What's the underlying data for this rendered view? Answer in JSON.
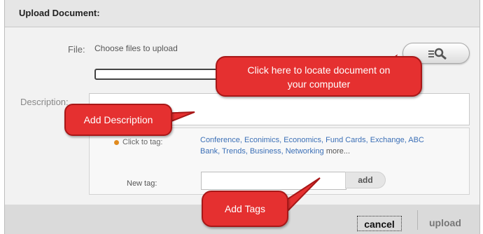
{
  "dialog": {
    "title": "Upload Document:",
    "file_label": "File:",
    "file_hint": "Choose files to upload",
    "browse_icon": "search-list-icon",
    "description_label": "Description:",
    "tags": {
      "prompt": "Click to tag:",
      "items": [
        "Conference",
        "Econimics",
        "Economics",
        "Fund Cards",
        "Exchange",
        "ABC Bank",
        "Trends",
        "Business",
        "Networking"
      ],
      "more": "more...",
      "new_tag_label": "New tag:",
      "add_label": "add"
    },
    "footer": {
      "cancel": "cancel",
      "upload": "upload"
    }
  },
  "callouts": {
    "locate_line1": "Click here to locate document on",
    "locate_line2": "your computer",
    "description": "Add Description",
    "tags": "Add Tags",
    "color": "#e53030"
  }
}
